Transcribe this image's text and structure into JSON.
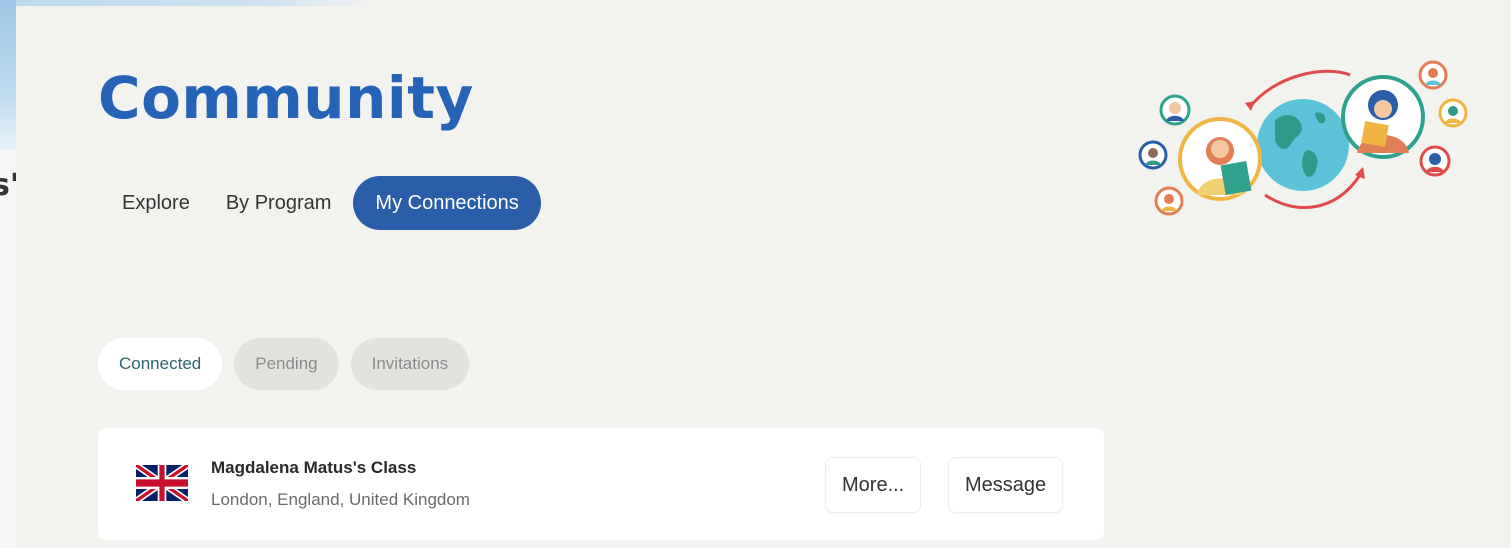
{
  "page": {
    "title": "Community",
    "left_fragment": "s'"
  },
  "main_tabs": [
    {
      "label": "Explore",
      "active": false
    },
    {
      "label": "By Program",
      "active": false
    },
    {
      "label": "My Connections",
      "active": true
    }
  ],
  "sub_tabs": [
    {
      "label": "Connected",
      "active": true
    },
    {
      "label": "Pending",
      "active": false
    },
    {
      "label": "Invitations",
      "active": false
    }
  ],
  "connections": [
    {
      "name": "Magdalena Matus's Class",
      "location": "London, England, United Kingdom",
      "flag_icon": "uk-flag-icon",
      "more_label": "More...",
      "message_label": "Message"
    }
  ],
  "colors": {
    "primary": "#2a5ea9",
    "title": "#2563b8",
    "background": "#f2f2ef",
    "active_subtab_text": "#2b6470"
  },
  "illustration_icon": "global-community-illustration"
}
